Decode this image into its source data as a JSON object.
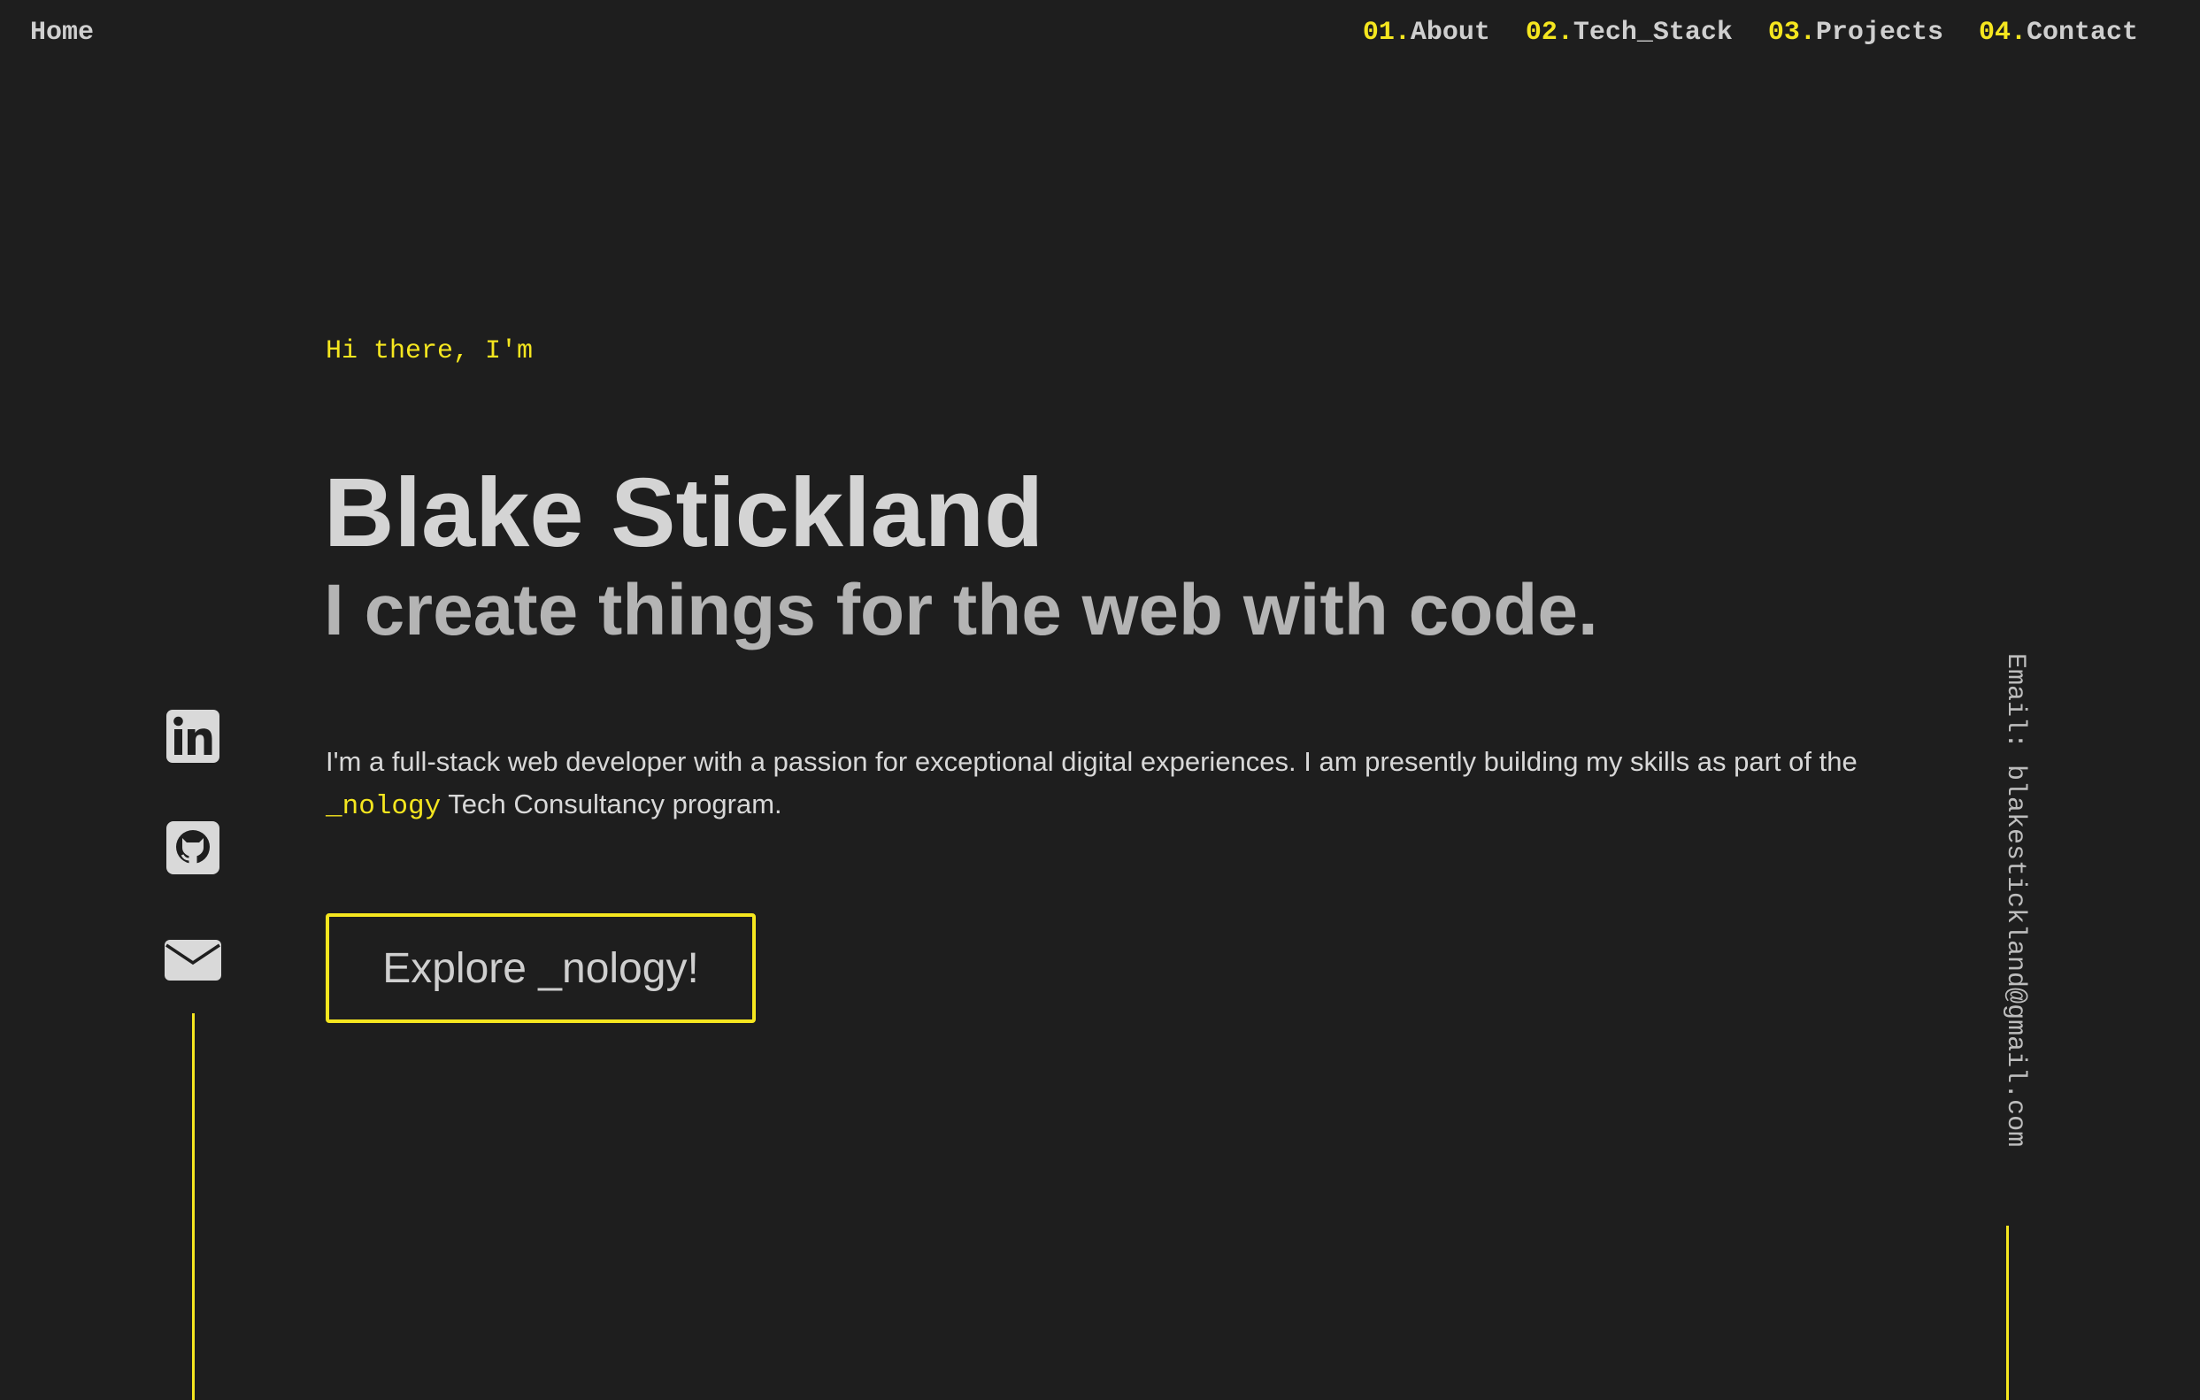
{
  "nav": {
    "home_label": "Home",
    "items": [
      {
        "num": "01.",
        "label": "About"
      },
      {
        "num": "02.",
        "label": "Tech_Stack"
      },
      {
        "num": "03.",
        "label": "Projects"
      },
      {
        "num": "04.",
        "label": "Contact"
      }
    ]
  },
  "hero": {
    "greeting": "Hi there, I'm",
    "name": "Blake Stickland",
    "tagline": "I create things for the web with code.",
    "intro_before": "I'm a full-stack web developer with a passion for exceptional digital experiences. I am presently building my skills as part of the ",
    "intro_highlight": "_nology",
    "intro_after": " Tech Consultancy program.",
    "cta_label": "Explore _nology!"
  },
  "social": {
    "icons": [
      "linkedin-icon",
      "github-icon",
      "mail-icon"
    ]
  },
  "email_sidebar": "Email: blakestickland@gmail.com",
  "colors": {
    "background": "#1e1e1e",
    "accent": "#f5e61f",
    "text": "#cfcfcf"
  }
}
